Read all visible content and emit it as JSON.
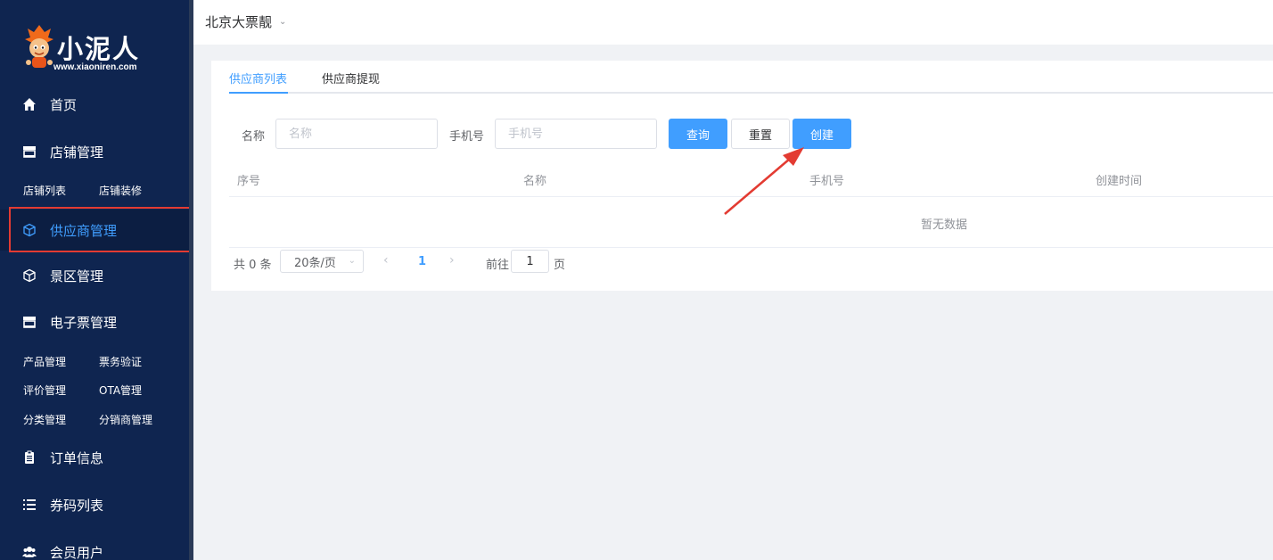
{
  "brand": {
    "name": "小泥人",
    "url": "www.xiaoniren.com"
  },
  "sidebar": {
    "items": [
      {
        "label": "首页",
        "icon": "home-icon"
      },
      {
        "label": "店铺管理",
        "icon": "store-icon",
        "children": [
          "店铺列表",
          "店铺装修"
        ]
      },
      {
        "label": "供应商管理",
        "icon": "cube-icon",
        "active": true
      },
      {
        "label": "景区管理",
        "icon": "cube-icon"
      },
      {
        "label": "电子票管理",
        "icon": "store-icon",
        "children": [
          "产品管理",
          "票务验证",
          "评价管理",
          "OTA管理",
          "分类管理",
          "分销商管理"
        ]
      },
      {
        "label": "订单信息",
        "icon": "clipboard-icon"
      },
      {
        "label": "券码列表",
        "icon": "list-icon"
      },
      {
        "label": "会员用户",
        "icon": "users-icon"
      }
    ]
  },
  "header": {
    "shop_name": "北京大票靓"
  },
  "tabs": [
    {
      "label": "供应商列表",
      "active": true
    },
    {
      "label": "供应商提现"
    }
  ],
  "filters": {
    "name_label": "名称",
    "name_placeholder": "名称",
    "phone_label": "手机号",
    "phone_placeholder": "手机号"
  },
  "buttons": {
    "query": "查询",
    "reset": "重置",
    "create": "创建"
  },
  "table": {
    "columns": [
      "序号",
      "名称",
      "手机号",
      "创建时间"
    ],
    "empty_text": "暂无数据"
  },
  "pagination": {
    "total_text": "共 0 条",
    "page_size": "20条/页",
    "current_page": "1",
    "goto_label": "前往",
    "goto_value": "1",
    "page_suffix": "页"
  },
  "colors": {
    "sidebar_bg": "#0f2550",
    "accent": "#409eff",
    "highlight": "#e33b32"
  }
}
